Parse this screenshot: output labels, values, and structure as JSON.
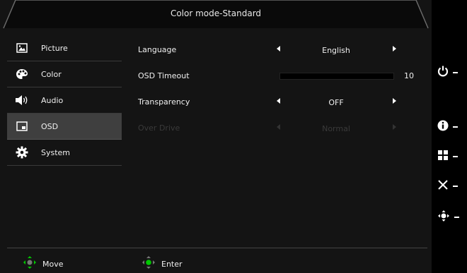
{
  "header": {
    "title": "Color mode-Standard"
  },
  "sidebar": {
    "items": [
      {
        "label": "Picture",
        "icon": "picture-icon",
        "active": false
      },
      {
        "label": "Color",
        "icon": "palette-icon",
        "active": false
      },
      {
        "label": "Audio",
        "icon": "speaker-icon",
        "active": false
      },
      {
        "label": "OSD",
        "icon": "osd-window-icon",
        "active": true
      },
      {
        "label": "System",
        "icon": "gear-icon",
        "active": false
      }
    ]
  },
  "main": {
    "rows": [
      {
        "label": "Language",
        "value": "English"
      },
      {
        "label": "OSD Timeout",
        "value": "10",
        "level": 0.1
      },
      {
        "label": "Transparency",
        "value": "OFF"
      },
      {
        "label": "Over Drive",
        "value": "Normal",
        "disabled": true
      }
    ]
  },
  "footer": {
    "move_label": "Move",
    "enter_label": "Enter"
  },
  "hotkeys": [
    "power-icon",
    "info-icon",
    "menu-grid-icon",
    "close-icon",
    "navigate-icon"
  ],
  "colors": {
    "accent": "#00c800",
    "active_bg": "#3f3f3f",
    "panel_bg": "#141414"
  }
}
